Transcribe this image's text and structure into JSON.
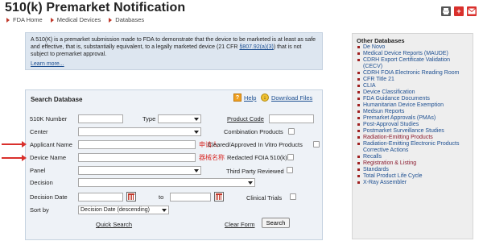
{
  "page": {
    "title": "510(k) Premarket Notification",
    "breadcrumb": [
      "FDA Home",
      "Medical Devices",
      "Databases"
    ]
  },
  "toolbar": {
    "print_icon": "print-icon",
    "add_icon": "plus-icon",
    "email_icon": "email-icon"
  },
  "info": {
    "text_part1": "A 510(K) is a premarket submission made to FDA to demonstrate that the device to be marketed is at least as safe and effective, that is, substantially equivalent, to a legally marketed device (21 CFR ",
    "cfr_link": "§807.92(a)(3)",
    "text_part2": ") that is not subject to premarket approval.",
    "learn_more": "Learn more..."
  },
  "search": {
    "header": "Search Database",
    "help": "Help",
    "download": "Download Files",
    "labels": {
      "k_number": "510K Number",
      "type": "Type",
      "product_code": "Product Code",
      "center": "Center",
      "combination_products": "Combination Products",
      "applicant_name": "Applicant Name",
      "cleared_ivd": "Cleared/Approved In Vitro Products",
      "device_name": "Device Name",
      "redacted_foia": "Redacted FOIA 510(k)",
      "panel": "Panel",
      "third_party": "Third Party Reviewed",
      "decision": "Decision",
      "decision_date": "Decision Date",
      "to": "to",
      "clinical_trials": "Clinical Trials",
      "sort_by": "Sort by"
    },
    "values": {
      "k_number": "",
      "type": "",
      "product_code": "",
      "center": "",
      "applicant_name": "",
      "device_name": "",
      "panel": "",
      "decision": "",
      "date_from": "",
      "date_to": "",
      "sort_by": "Decision Date (descending)"
    },
    "quick_search": "Quick Search",
    "clear_form": "Clear Form",
    "search_button": "Search"
  },
  "annotations": {
    "applicant_cn": "申请人",
    "device_cn": "器械名称",
    "color": "#d9302c"
  },
  "sidebar": {
    "title": "Other Databases",
    "items": [
      "De Novo",
      "Medical Device Reports (MAUDE)",
      "CDRH Export Certificate Validation (CECV)",
      "CDRH FOIA Electronic Reading Room",
      "CFR Title 21",
      "CLIA",
      "Device Classification",
      "FDA Guidance Documents",
      "Humanitarian Device Exemption",
      "Medsun Reports",
      "Premarket Approvals (PMAs)",
      "Post-Approval Studies",
      "Postmarket Surveillance Studies",
      "Radiation-Emitting Products",
      "Radiation-Emitting Electronic Products Corrective Actions",
      "Recalls",
      "Registration & Listing",
      "Standards",
      "Total Product Life Cycle",
      "X-Ray Assembler"
    ]
  }
}
